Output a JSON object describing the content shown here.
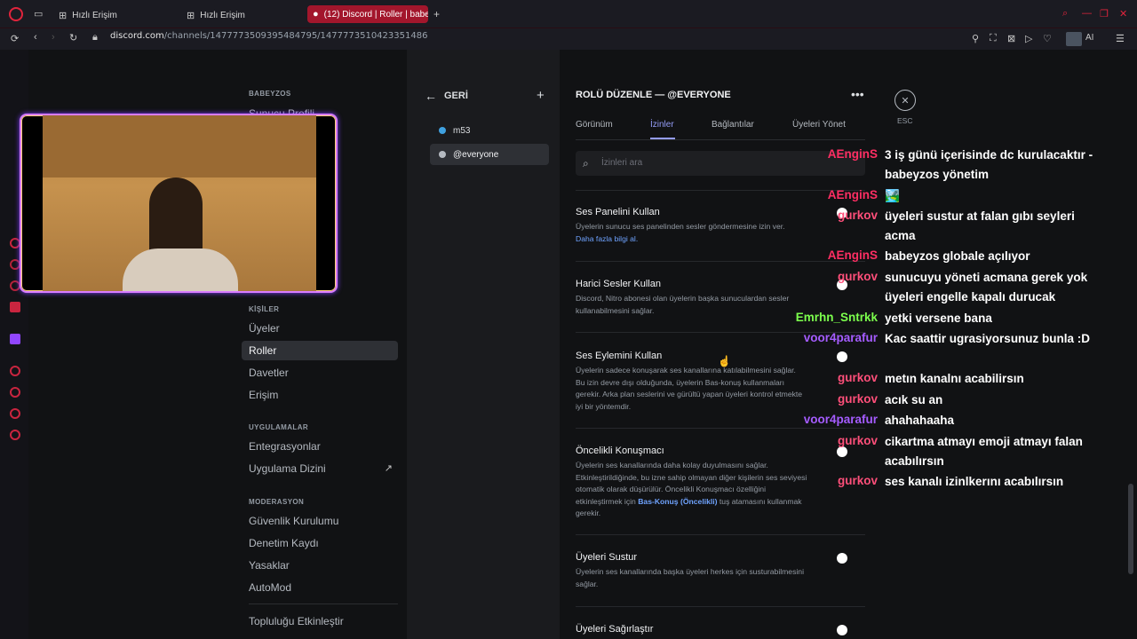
{
  "browser": {
    "tabs": [
      {
        "label": "Hızlı Erişim"
      },
      {
        "label": "Hızlı Erişim"
      },
      {
        "label": "(12) Discord | Roller | babe"
      }
    ],
    "url_host": "discord.com",
    "url_path": "/channels/1477773509395484795/1477773510423351486",
    "ai_label": "AI"
  },
  "sidebar": {
    "server_header": "BABEYZOS",
    "server_sub": "Sunucu Profili",
    "people_header": "KİŞİLER",
    "people_items": [
      "Üyeler",
      "Roller",
      "Davetler",
      "Erişim"
    ],
    "apps_header": "UYGULAMALAR",
    "apps_items": [
      "Entegrasyonlar",
      "Uygulama Dizini"
    ],
    "mod_header": "MODERASYON",
    "mod_items": [
      "Güvenlik Kurulumu",
      "Denetim Kaydı",
      "Yasaklar",
      "AutoMod"
    ],
    "community_item": "Topluluğu Etkinleştir"
  },
  "roles": {
    "back_label": "GERİ",
    "add_icon": "plus-icon",
    "items": [
      {
        "name": "m53",
        "color": "#3fa1e0"
      },
      {
        "name": "@everyone",
        "color": "#b5bac1"
      }
    ]
  },
  "editor": {
    "title": "ROLÜ DÜZENLE — @EVERYONE",
    "tabs": [
      "Görünüm",
      "İzinler",
      "Bağlantılar",
      "Üyeleri Yönet"
    ],
    "active_tab": "İzinler",
    "search_placeholder": "İzinleri ara",
    "close_label": "ESC",
    "permissions": [
      {
        "title": "Ses Panelini Kullan",
        "desc": "Üyelerin sunucu ses panelinden sesler göndermesine izin ver.",
        "link": "Daha fazla bilgi al."
      },
      {
        "title": "Harici Sesler Kullan",
        "desc": "Discord, Nitro abonesi olan üyelerin başka sunuculardan sesler kullanabilmesini sağlar."
      },
      {
        "title": "Ses Eylemini Kullan",
        "desc": "Üyelerin sadece konuşarak ses kanallarına katılabilmesini sağlar. Bu izin devre dışı olduğunda, üyelerin Bas-konuş kullanmaları gerekir. Arka plan seslerini ve gürültü yapan üyeleri kontrol etmekte iyi bir yöntemdir."
      },
      {
        "title": "Öncelikli Konuşmacı",
        "desc_pre": "Üyelerin ses kanallarında daha kolay duyulmasını sağlar. Etkinleştirildiğinde, bu izne sahip olmayan diğer kişilerin ses seviyesi otomatik olarak düşürülür. Öncelikli Konuşmacı özelliğini etkinleştirmek için",
        "link": "Bas-Konuş (Öncelikli)",
        "desc_post": "tuş atamasını kullanmak gerekir."
      },
      {
        "title": "Üyeleri Sustur",
        "desc": "Üyelerin ses kanallarında başka üyeleri herkes için susturabilmesini sağlar."
      },
      {
        "title": "Üyeleri Sağırlaştır",
        "desc": ""
      }
    ]
  },
  "chat": [
    {
      "user": "AEnginS",
      "color": "#ff2e63",
      "msg": "3 iş günü içerisinde dc kurulacaktır - babeyzos yönetim"
    },
    {
      "user": "AEnginS",
      "color": "#ff2e63",
      "msg": "🏞️"
    },
    {
      "user": "gurkov",
      "color": "#ff4f7a",
      "msg": "üyeleri sustur at falan gıbı seyleri acma"
    },
    {
      "user": "AEnginS",
      "color": "#ff2e63",
      "msg": "babeyzos globale açılıyor"
    },
    {
      "user": "gurkov",
      "color": "#ff4f7a",
      "msg": "sunucuyu yöneti acmana gerek yok üyeleri engelle kapalı durucak"
    },
    {
      "user": "Emrhn_Sntrkk",
      "color": "#7cff4d",
      "msg": "yetki versene bana"
    },
    {
      "user": "voor4parafur",
      "color": "#a55cff",
      "msg": "Kac saattir ugrasiyorsunuz bunla :D"
    },
    {
      "user": "gurkov",
      "color": "#ff4f7a",
      "msg": "metın kanalnı acabilirsın"
    },
    {
      "user": "gurkov",
      "color": "#ff4f7a",
      "msg": "acık su an"
    },
    {
      "user": "voor4parafur",
      "color": "#a55cff",
      "msg": "ahahahaaha"
    },
    {
      "user": "gurkov",
      "color": "#ff4f7a",
      "msg": "cikartma atmayı emoji atmayı falan acabılırsın"
    },
    {
      "user": "gurkov",
      "color": "#ff4f7a",
      "msg": "ses kanalı izinlkerını acabılırsın"
    }
  ]
}
